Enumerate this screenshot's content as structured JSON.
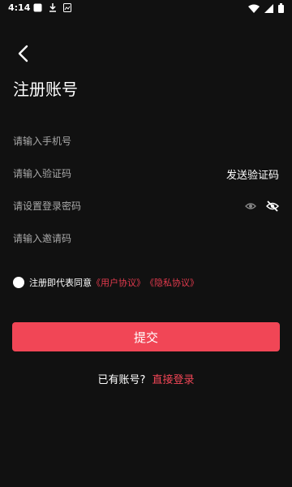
{
  "status_bar": {
    "time": "4:14",
    "icons": [
      "app-square-icon",
      "download-icon",
      "photo-icon",
      "wifi-icon",
      "signal-icon",
      "battery-icon"
    ]
  },
  "header": {
    "back_icon": "chevron-left-icon",
    "title": "注册账号"
  },
  "form": {
    "phone": {
      "placeholder": "请输入手机号",
      "value": ""
    },
    "code": {
      "placeholder": "请输入验证码",
      "value": "",
      "send_label": "发送验证码"
    },
    "password": {
      "placeholder": "请设置登录密码",
      "value": "",
      "icons": [
        "eye-icon",
        "eye-off-icon"
      ]
    },
    "invite": {
      "placeholder": "请输入邀请码",
      "value": ""
    }
  },
  "agreement": {
    "prefix": "注册即代表同意",
    "user_agreement": "《用户协议》",
    "privacy_agreement": "《隐私协议》",
    "checked": false
  },
  "submit": {
    "label": "提交"
  },
  "login": {
    "prompt": "已有账号?",
    "link": "直接登录"
  },
  "colors": {
    "background": "#111111",
    "accent": "#f14656",
    "link": "#e23a4d",
    "placeholder": "#a9a9a9"
  }
}
